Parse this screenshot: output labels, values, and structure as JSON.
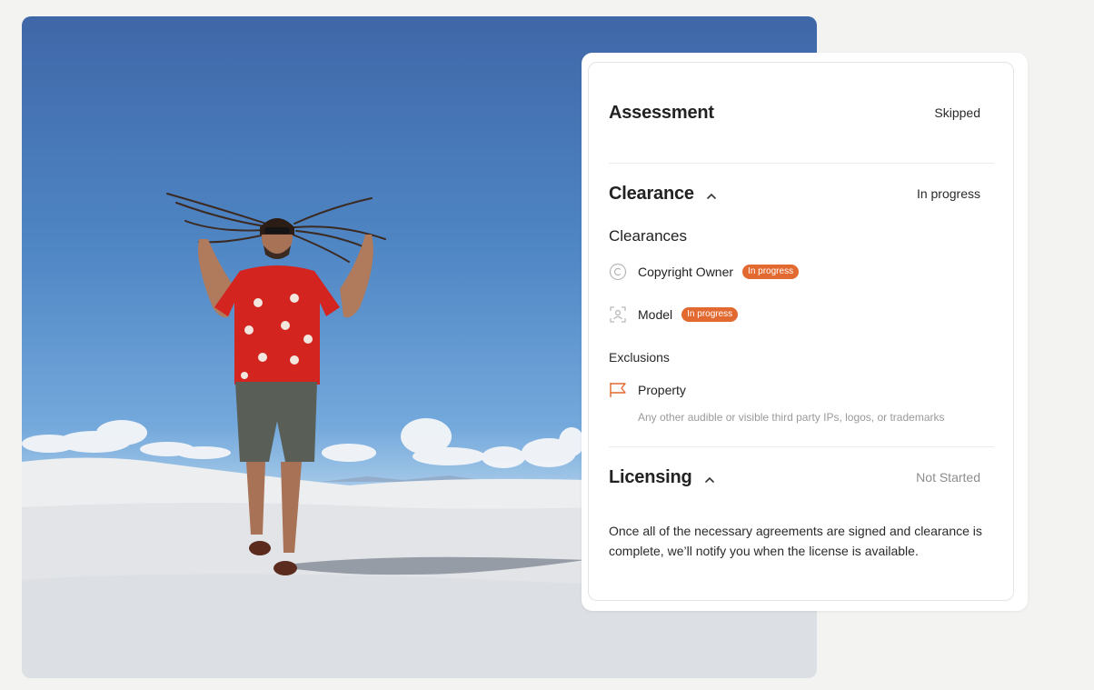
{
  "assessment": {
    "title": "Assessment",
    "status": "Skipped"
  },
  "clearance": {
    "title": "Clearance",
    "status": "In progress",
    "clearances_heading": "Clearances",
    "items": [
      {
        "label": "Copyright Owner",
        "badge": "In progress",
        "icon": "copyright-icon"
      },
      {
        "label": "Model",
        "badge": "In progress",
        "icon": "person-scan-icon"
      }
    ],
    "exclusions_heading": "Exclusions",
    "exclusions": [
      {
        "label": "Property",
        "hint": "Any other audible or visible third party IPs, logos, or trademarks",
        "icon": "flag-icon"
      }
    ]
  },
  "licensing": {
    "title": "Licensing",
    "status": "Not Started",
    "message": "Once all of the necessary agreements are signed and clearance is complete, we’ll notify you when the license is available."
  },
  "colors": {
    "badge": "#e2692f",
    "flag_icon": "#e2692f",
    "muted_status": "#8d8d8d"
  }
}
